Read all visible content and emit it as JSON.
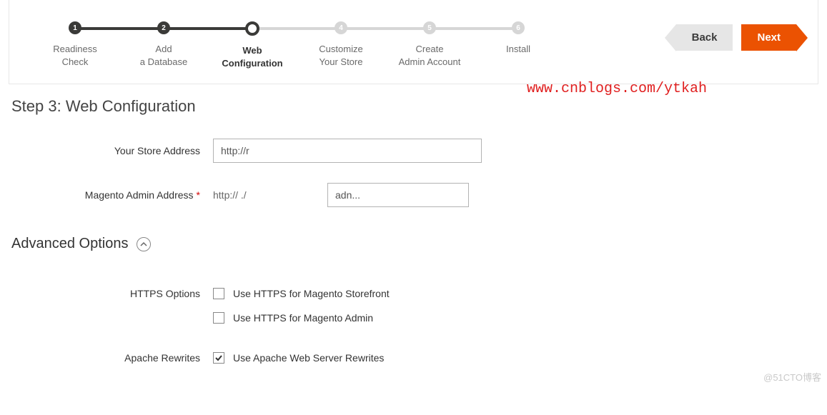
{
  "steps": [
    {
      "num": "1",
      "label": "Readiness\nCheck"
    },
    {
      "num": "2",
      "label": "Add\na Database"
    },
    {
      "num": "3",
      "label": "Web\nConfiguration"
    },
    {
      "num": "4",
      "label": "Customize\nYour Store"
    },
    {
      "num": "5",
      "label": "Create\nAdmin Account"
    },
    {
      "num": "6",
      "label": "Install"
    }
  ],
  "nav": {
    "back": "Back",
    "next": "Next"
  },
  "watermark_url": "www.cnblogs.com/ytkah",
  "page_title": "Step 3: Web Configuration",
  "form": {
    "store_address_label": "Your Store Address",
    "store_address_value": "http://r",
    "admin_address_label": "Magento Admin Address",
    "admin_prefix": "http://                          ./",
    "admin_path_value": "adn..."
  },
  "advanced": {
    "title": "Advanced Options",
    "https_options_label": "HTTPS Options",
    "https_storefront": "Use HTTPS for Magento Storefront",
    "https_admin": "Use HTTPS for Magento Admin",
    "apache_label": "Apache Rewrites",
    "apache_rewrites": "Use Apache Web Server Rewrites"
  },
  "bottom_watermark": "@51CTO博客"
}
